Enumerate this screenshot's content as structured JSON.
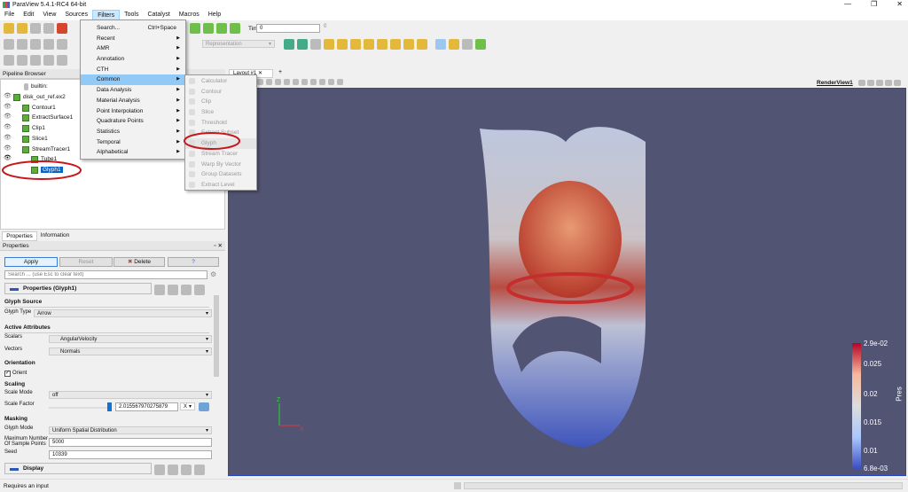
{
  "window": {
    "title": "ParaView 5.4.1-RC4 64-bit"
  },
  "menubar": [
    "File",
    "Edit",
    "View",
    "Sources",
    "Filters",
    "Tools",
    "Catalyst",
    "Macros",
    "Help"
  ],
  "toolbar": {
    "time_label": "Time:",
    "time_value": "0",
    "time_index": "0",
    "representation": "Representation"
  },
  "filters_menu": {
    "items": [
      {
        "label": "Search...",
        "shortcut": "Ctrl+Space"
      },
      {
        "label": "Recent"
      },
      {
        "label": "AMR"
      },
      {
        "label": "Annotation"
      },
      {
        "label": "CTH"
      },
      {
        "label": "Common"
      },
      {
        "label": "Data Analysis"
      },
      {
        "label": "Material Analysis"
      },
      {
        "label": "Point Interpolation"
      },
      {
        "label": "Quadrature Points"
      },
      {
        "label": "Statistics"
      },
      {
        "label": "Temporal"
      },
      {
        "label": "Alphabetical"
      }
    ],
    "highlighted": "Common"
  },
  "common_submenu": [
    "Calculator",
    "Contour",
    "Clip",
    "Slice",
    "Threshold",
    "Extract Subset",
    "Glyph",
    "Stream Tracer",
    "Warp By Vector",
    "Group Datasets",
    "Extract Level"
  ],
  "pipeline": {
    "title": "Pipeline Browser",
    "nodes": [
      "builtin:",
      "disk_out_ref.ex2",
      "Contour1",
      "ExtractSurface1",
      "Clip1",
      "Slice1",
      "StreamTracer1",
      "Tube1",
      "Glyph1"
    ],
    "selected": "Glyph1"
  },
  "tabs": {
    "properties": "Properties",
    "information": "Information",
    "layout": "Layout #1"
  },
  "properties": {
    "title": "Properties",
    "apply": "Apply",
    "reset": "Reset",
    "delete": "Delete",
    "help": "?",
    "search_placeholder": "Search ... (use Esc to clear text)",
    "group_title": "Properties (Glyph1)",
    "glyph_source": "Glyph Source",
    "glyph_type_label": "Glyph Type",
    "glyph_type": "Arrow",
    "active_attributes": "Active Attributes",
    "scalars_label": "Scalars",
    "scalars": "AngularVelocity",
    "vectors_label": "Vectors",
    "vectors": "Normals",
    "orientation": "Orientation",
    "orient": "Orient",
    "scaling": "Scaling",
    "scale_mode_label": "Scale Mode",
    "scale_mode": "off",
    "scale_factor_label": "Scale Factor",
    "scale_factor": "2.015567970275879",
    "scale_axis": "X",
    "masking": "Masking",
    "glyph_mode_label": "Glyph Mode",
    "glyph_mode": "Uniform Spatial Distribution",
    "max_points_label_1": "Maximum Number",
    "max_points_label_2": "Of Sample Points",
    "max_points": "5000",
    "seed_label": "Seed",
    "seed": "10339",
    "display": "Display"
  },
  "render_view": {
    "title": "RenderView1",
    "background": "#525473"
  },
  "colorbar": {
    "title": "Pres",
    "ticks": [
      "2.9e-02",
      "0.025",
      "0.02",
      "0.015",
      "0.01",
      "6.8e-03"
    ],
    "colors": [
      "#b40426",
      "#f7b89c",
      "#dddddd",
      "#aac7fd",
      "#3b4cc0"
    ]
  },
  "status": {
    "text": "Requires an input"
  }
}
